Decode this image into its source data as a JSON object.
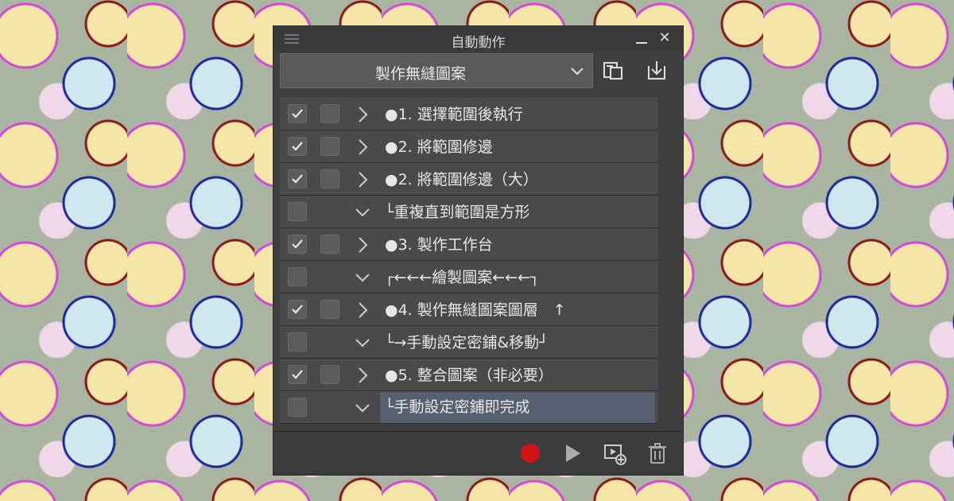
{
  "panel": {
    "title": "自動動作"
  },
  "dropdown": {
    "selected": "製作無縫圖案"
  },
  "toolbar": {
    "icons": [
      "duplicate-set-icon",
      "import-icon"
    ]
  },
  "actions": [
    {
      "label": "●1. 選擇範圍後執行",
      "checked": true,
      "expanded": false
    },
    {
      "label": "●2. 將範圍修邊",
      "checked": true,
      "expanded": false
    },
    {
      "label": "●2. 將範圍修邊（大）",
      "checked": true,
      "expanded": false
    },
    {
      "label": "└重複直到範圍是方形",
      "checked": false,
      "expanded": true
    },
    {
      "label": "●3. 製作工作台",
      "checked": true,
      "expanded": false
    },
    {
      "label": "┌←←←繪製圖案←←←┐",
      "checked": false,
      "expanded": true
    },
    {
      "label": "●4. 製作無縫圖案圖層　↑",
      "checked": true,
      "expanded": false
    },
    {
      "label": "└→手動設定密鋪&移動┘",
      "checked": false,
      "expanded": true
    },
    {
      "label": "●5. 整合圖案（非必要）",
      "checked": true,
      "expanded": false
    },
    {
      "label": "└手動設定密鋪即完成",
      "checked": false,
      "expanded": true,
      "selected": true
    }
  ],
  "footer": {
    "icons": [
      "record-icon",
      "play-icon",
      "add-action-icon",
      "trash-icon"
    ],
    "record_color": "#d01414"
  }
}
